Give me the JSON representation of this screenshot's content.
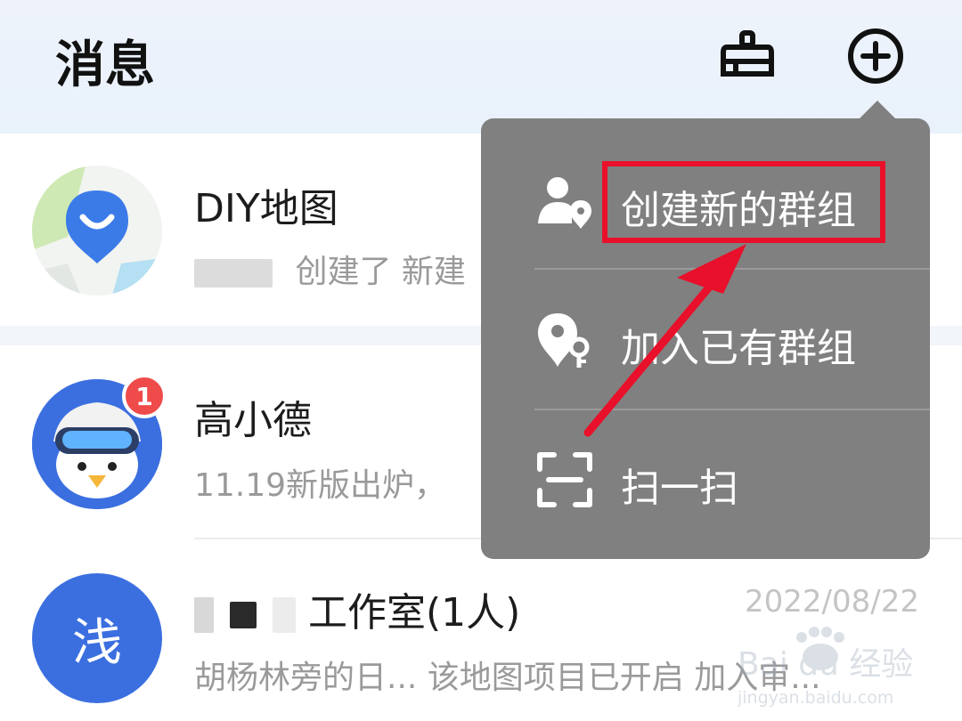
{
  "header": {
    "title": "消息",
    "icons": [
      "broom-icon",
      "add-circle-icon"
    ]
  },
  "conversations": [
    {
      "name": "DIY地图",
      "preview": "创建了 新建",
      "avatar": "diy-map-logo"
    },
    {
      "name": "高小德",
      "preview": "11.19新版出炉，",
      "avatar": "penguin-mascot",
      "badge": "1"
    },
    {
      "name": "工作室(1人)",
      "preview": "胡杨林旁的日... 该地图项目已开启 加入审...",
      "date": "2022/08/22",
      "avatar_text": "浅"
    }
  ],
  "popup_menu": {
    "items": [
      {
        "label": "创建新的群组",
        "icon": "user-location-icon",
        "highlighted": true
      },
      {
        "label": "加入已有群组",
        "icon": "location-key-icon"
      },
      {
        "label": "扫一扫",
        "icon": "scan-icon"
      }
    ]
  },
  "colors": {
    "menu_bg": "#808080",
    "highlight": "#e8102a",
    "avatar_blue": "#3b6fe0",
    "badge_red": "#ef4b4b"
  },
  "watermark": {
    "brand": "Bai du 经验",
    "url": "jingyan.baidu.com"
  }
}
